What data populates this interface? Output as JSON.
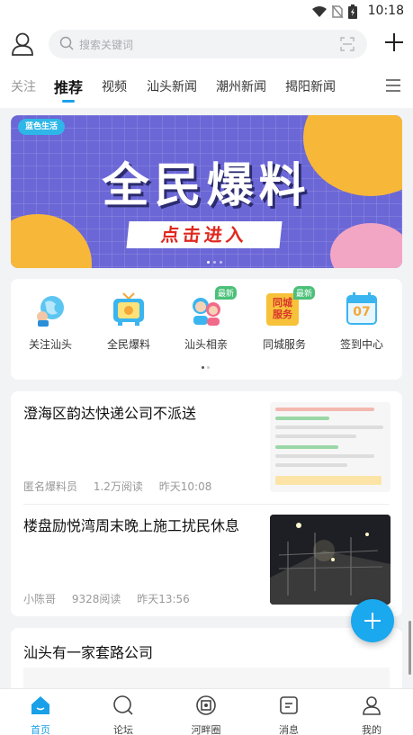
{
  "status_bar": {
    "time": "10:18"
  },
  "header": {
    "search_placeholder": "搜索关键词"
  },
  "tabs": [
    {
      "label": "关注"
    },
    {
      "label": "推荐"
    },
    {
      "label": "视频"
    },
    {
      "label": "汕头新闻"
    },
    {
      "label": "潮州新闻"
    },
    {
      "label": "揭阳新闻"
    }
  ],
  "banner": {
    "logo_text": "蓝色生活",
    "title": "全民爆料",
    "subtitle": "点击进入"
  },
  "quick_actions": [
    {
      "label": "关注汕头",
      "icon": "globe-icon",
      "badge": ""
    },
    {
      "label": "全民爆料",
      "icon": "tv-icon",
      "badge": ""
    },
    {
      "label": "汕头相亲",
      "icon": "couple-icon",
      "badge": "最新"
    },
    {
      "label": "同城服务",
      "icon": "city-service-icon",
      "badge": "最新",
      "icon_text": "同城服务"
    },
    {
      "label": "签到中心",
      "icon": "calendar-icon",
      "badge": "",
      "icon_text": "07"
    }
  ],
  "feed": [
    {
      "title": "澄海区韵达快递公司不派送",
      "author": "匿名爆料员",
      "reads": "1.2万阅读",
      "time": "昨天10:08"
    },
    {
      "title": "楼盘励悦湾周末晚上施工扰民休息",
      "author": "小陈哥",
      "reads": "9328阅读",
      "time": "昨天13:56"
    },
    {
      "title": "汕头有一家套路公司"
    }
  ],
  "bottom_nav": [
    {
      "label": "首页",
      "icon": "home-icon",
      "active": true
    },
    {
      "label": "论坛",
      "icon": "forum-icon",
      "active": false
    },
    {
      "label": "河畔圈",
      "icon": "circle-icon",
      "active": false
    },
    {
      "label": "消息",
      "icon": "message-icon",
      "active": false
    },
    {
      "label": "我的",
      "icon": "profile-icon",
      "active": false
    }
  ],
  "colors": {
    "accent": "#1aa0e8",
    "banner_bg": "#6b67d6",
    "banner_accent": "#f7b83a",
    "badge": "#4cc07a"
  }
}
